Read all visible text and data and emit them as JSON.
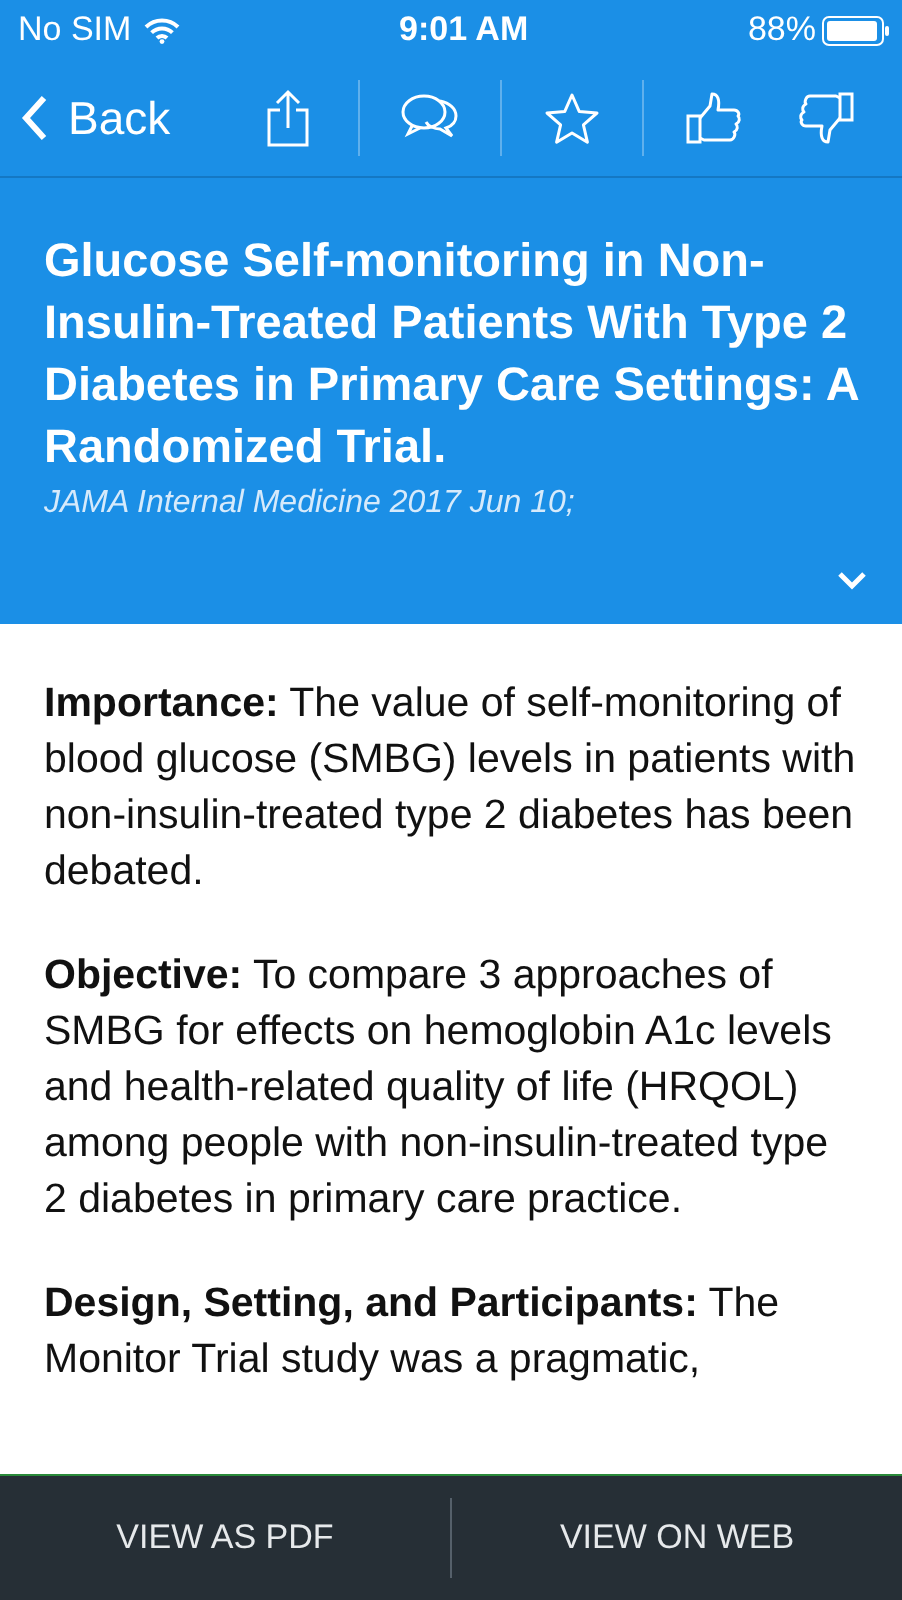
{
  "status_bar": {
    "carrier": "No SIM",
    "time": "9:01 AM",
    "battery": "88%"
  },
  "toolbar": {
    "back": "Back"
  },
  "article": {
    "title": "Glucose Self-monitoring in Non-Insulin-Treated Patients With Type 2 Diabetes in Primary Care Settings: A Randomized Trial.",
    "source": "JAMA Internal Medicine 2017 Jun 10;",
    "expanded": false
  },
  "sections": [
    {
      "text": "**Importance:** The value of self-monitoring of blood glucose (SMBG) levels in patients with non-insulin-treated type 2 diabetes has been debated."
    },
    {
      "text": "**Objective:** To compare 3 approaches of SMBG for effects on hemoglobin A1c levels and health-related quality of life (HRQOL) among people with non-insulin-treated type 2 diabetes in primary care practice."
    },
    {
      "text": "**Design, Setting, and Participants:** The Monitor Trial study was a pragmatic,"
    }
  ],
  "bottom_bar": [
    "VIEW AS PDF",
    "VIEW ON WEB"
  ]
}
